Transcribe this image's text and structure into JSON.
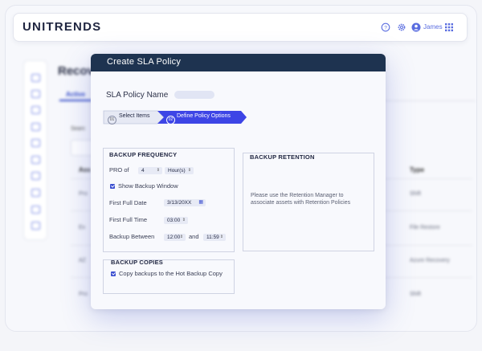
{
  "header": {
    "logo": "UNITRENDS",
    "user_name": "James",
    "icons": [
      "help-icon",
      "settings-icon",
      "user-icon",
      "apps-grid-icon"
    ]
  },
  "background_page": {
    "title": "Recov",
    "tab": "Active",
    "search_label": "Searc",
    "columns": [
      "Ass",
      "Type"
    ],
    "rows": [
      {
        "name": "Pro",
        "type": "Shift"
      },
      {
        "name": "Ex",
        "type": "File Restore"
      },
      {
        "name": "AZ",
        "type": "Azure Recovery"
      },
      {
        "name": "Pro",
        "type": "Shift"
      }
    ]
  },
  "modal": {
    "title": "Create SLA Policy",
    "policy_name_label": "SLA Policy Name",
    "policy_name_value": "",
    "steps": [
      {
        "num": "01",
        "label": "Select Items"
      },
      {
        "num": "02",
        "label": "Define Policy Options"
      }
    ],
    "frequency": {
      "title": "BACKUP FREQUENCY",
      "pro_of_label": "PRO of",
      "pro_of_value": "4",
      "unit_value": "Hour(s)",
      "show_window_label": "Show Backup Window",
      "first_full_date_label": "First Full Date",
      "first_full_date_value": "3/13/20XX",
      "first_full_time_label": "First Full Time",
      "first_full_time_value": "03:00",
      "between_label": "Backup Between",
      "between_start": "12:00",
      "between_and": "and",
      "between_end": "11:59"
    },
    "retention": {
      "title": "BACKUP RETENTION",
      "note": "Please use the Retention Manager to associate assets with Retention Policies"
    },
    "copies": {
      "title": "BACKUP COPIES",
      "copy_hot_label": "Copy backups to the Hot Backup Copy"
    }
  },
  "colors": {
    "header_bar": "#1e3350",
    "accent": "#3b4fd0",
    "step_active": "#3d45e6"
  }
}
